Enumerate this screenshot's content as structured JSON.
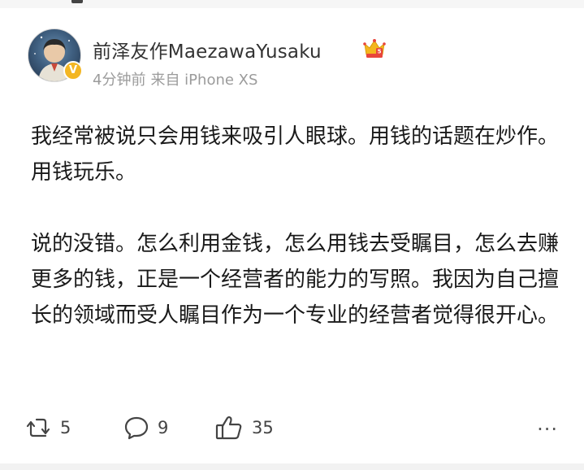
{
  "post": {
    "author": {
      "name": "前泽友作MaezawaYusaku",
      "verified_mark": "V"
    },
    "meta": {
      "time": "4分钟前",
      "source": "来自 iPhone XS"
    },
    "paragraphs": [
      "我经常被说只会用钱来吸引人眼球。用钱的话题在炒作。用钱玩乐。",
      "说的没错。怎么利用金钱，怎么用钱去受瞩目，怎么去赚更多的钱，正是一个经营者的能力的写照。我因为自己擅长的领域而受人瞩目作为一个专业的经营者觉得很开心。"
    ],
    "actions": {
      "repost_count": "5",
      "comment_count": "9",
      "like_count": "35",
      "more_label": "···"
    }
  },
  "icons": {
    "repost": "repost-icon",
    "comment": "comment-icon",
    "like": "thumbs-up-icon",
    "vip": "crown-badge-icon"
  },
  "colors": {
    "badge_gold": "#f3b623",
    "crown_red": "#e8453c",
    "text": "#1a1a1a",
    "meta": "#9b9b9b"
  }
}
